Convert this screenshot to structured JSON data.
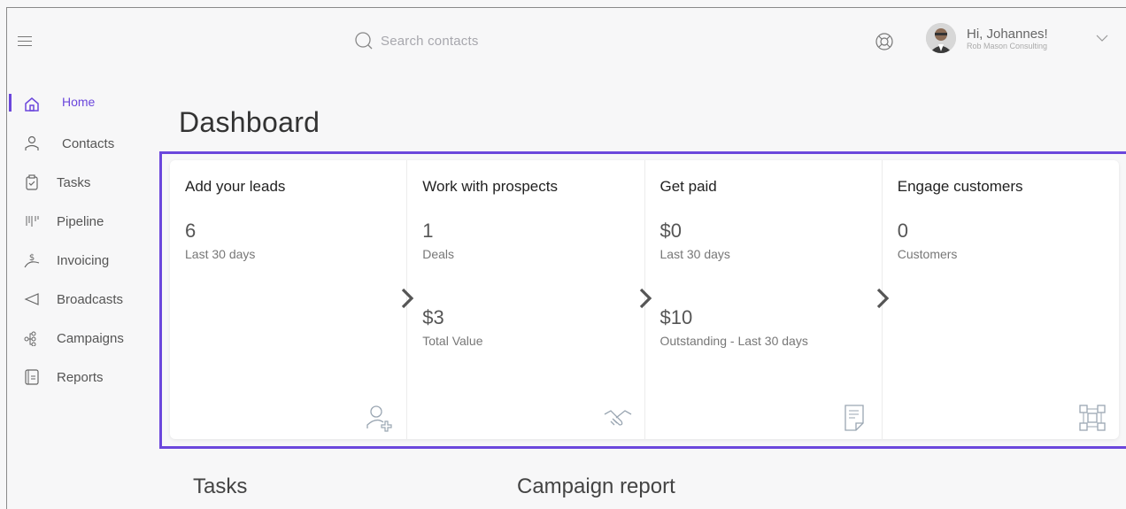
{
  "header": {
    "search_placeholder": "Search contacts",
    "greeting": "Hi, Johannes!",
    "company": "Rob Mason Consulting"
  },
  "sidebar": {
    "items": [
      {
        "label": "Home",
        "icon": "home-icon"
      },
      {
        "label": "Contacts",
        "icon": "user-icon"
      },
      {
        "label": "Tasks",
        "icon": "clipboard-icon"
      },
      {
        "label": "Pipeline",
        "icon": "pipeline-icon"
      },
      {
        "label": "Invoicing",
        "icon": "dollar-icon"
      },
      {
        "label": "Broadcasts",
        "icon": "megaphone-icon"
      },
      {
        "label": "Campaigns",
        "icon": "flow-icon"
      },
      {
        "label": "Reports",
        "icon": "report-icon"
      }
    ]
  },
  "page": {
    "title": "Dashboard"
  },
  "cards": [
    {
      "title": "Add your leads",
      "value1": "6",
      "label1": "Last 30 days",
      "icon": "add-user-icon"
    },
    {
      "title": "Work with prospects",
      "value1": "1",
      "label1": "Deals",
      "value2": "$3",
      "label2": "Total Value",
      "icon": "handshake-icon"
    },
    {
      "title": "Get paid",
      "value1": "$0",
      "label1": "Last 30 days",
      "value2": "$10",
      "label2": "Outstanding - Last 30 days",
      "icon": "invoice-icon"
    },
    {
      "title": "Engage customers",
      "value1": "0",
      "label1": "Customers",
      "icon": "network-icon"
    }
  ],
  "sections": {
    "tasks": "Tasks",
    "campaign_report": "Campaign report"
  },
  "colors": {
    "accent": "#6b47dc"
  }
}
